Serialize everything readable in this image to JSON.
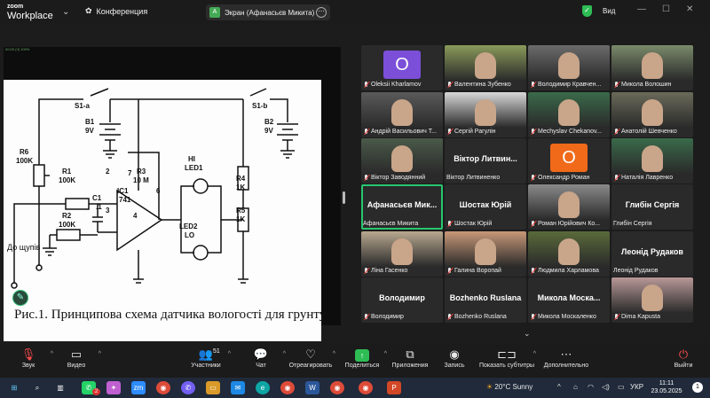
{
  "app": {
    "logo_line1": "zoom",
    "logo_line2": "Workplace",
    "conference_label": "Конференция"
  },
  "share": {
    "avatar_letter": "A",
    "label": "Экран (Афанасьєв Микита)",
    "more_symbol": "⋯"
  },
  "header_right": {
    "view_label": "Вид"
  },
  "screen": {
    "meta": "00:00 (!!) 100%",
    "schematic_labels": {
      "s1a": "S1-a",
      "s1b": "S1-b",
      "b1": "B1",
      "b1v": "9V",
      "b2": "B2",
      "b2v": "9V",
      "r6": "R6",
      "r6v": "100K",
      "r1": "R1",
      "r1v": "100K",
      "c1": "C1",
      "c1v": ".1",
      "r2": "R2",
      "r2v": "100K",
      "ic1": "IC1",
      "ic1v": "741",
      "r3": "R3",
      "r3v": "10 M",
      "pin2": "2",
      "pin3": "3",
      "pin7": "7",
      "pin6": "6",
      "pin4": "4",
      "hi": "HI",
      "led1": "LED1",
      "led2": "LED2",
      "lo": "LO",
      "r4": "R4",
      "r4v": "1K",
      "r5": "R5",
      "r5v": "1K",
      "probes": "До щупів"
    },
    "caption": "Рис.1. Принципова схема датчика вологості для грунту"
  },
  "participants": [
    {
      "name": "Oleksii Kharlamov",
      "muted": true,
      "type": "letter",
      "letter": "O",
      "color": "#7b4fd8"
    },
    {
      "name": "Валентина Зубенко",
      "muted": true,
      "type": "camera",
      "color": "#8a9a5a"
    },
    {
      "name": "Володимир Кравчен...",
      "muted": true,
      "type": "camera",
      "color": "#6b6b6b"
    },
    {
      "name": "Микола Волошин",
      "muted": true,
      "type": "camera",
      "color": "#7a8a6a"
    },
    {
      "name": "Андрій Васильович Т...",
      "muted": true,
      "type": "camera",
      "color": "#5a5a5a"
    },
    {
      "name": "Сергій Рагулін",
      "muted": true,
      "type": "camera",
      "color": "#d8d8d8"
    },
    {
      "name": "Mechyslav Chekanov...",
      "muted": true,
      "type": "camera",
      "color": "#3a6a4a"
    },
    {
      "name": "Анатолій Шевченко",
      "muted": true,
      "type": "camera",
      "color": "#6a6a5a"
    },
    {
      "name": "Віктор Заводянний",
      "muted": true,
      "type": "camera",
      "color": "#4a5a4a"
    },
    {
      "name": "Віктор Литвиненко",
      "muted": false,
      "type": "name",
      "display": "Віктор  Литвин..."
    },
    {
      "name": "Олександр Роман",
      "muted": true,
      "type": "letter",
      "letter": "O",
      "color": "#f06a1a"
    },
    {
      "name": "Наталія Лавренко",
      "muted": true,
      "type": "camera",
      "color": "#3a6a4a"
    },
    {
      "name": "Афанасьєв Микита",
      "muted": false,
      "type": "name",
      "display": "Афанасьєв  Мик...",
      "active": true
    },
    {
      "name": "Шостак Юрій",
      "muted": true,
      "type": "name",
      "display": "Шостак Юрій"
    },
    {
      "name": "Роман Юрійович Ко...",
      "muted": true,
      "type": "camera",
      "color": "#8a8a8a"
    },
    {
      "name": "Глибін Сергія",
      "muted": false,
      "type": "name",
      "display": "Глибін Сергія"
    },
    {
      "name": "Ліна Гасенко",
      "muted": true,
      "type": "camera",
      "color": "#b8a890"
    },
    {
      "name": "Галина Воропай",
      "muted": true,
      "type": "camera",
      "color": "#c89878"
    },
    {
      "name": "Людмила Харламова",
      "muted": true,
      "type": "camera",
      "color": "#5a6a3a"
    },
    {
      "name": "Леонід Рудаков",
      "muted": false,
      "type": "name",
      "display": "Леонід Рудаков"
    },
    {
      "name": "Володимир",
      "muted": true,
      "type": "name",
      "display": "Володимир"
    },
    {
      "name": "Bozhenko Ruslana",
      "muted": true,
      "type": "name",
      "display": "Bozhenko Ruslana"
    },
    {
      "name": "Микола Москаленко",
      "muted": true,
      "type": "name",
      "display": "Микола  Моска..."
    },
    {
      "name": "Dima Kapusta",
      "muted": true,
      "type": "camera",
      "color": "#b89898"
    }
  ],
  "toolbar": {
    "audio": "Звук",
    "video": "Видео",
    "participants": "Участники",
    "participants_count": "51",
    "chat": "Чат",
    "react": "Отреагировать",
    "share": "Поделиться",
    "apps": "Приложения",
    "record": "Запись",
    "captions": "Показать субтитры",
    "more": "Дополнительно",
    "exit": "Выйти"
  },
  "taskbar": {
    "badge": "2",
    "weather": "20°C  Sunny",
    "lang": "УКР",
    "time": "11:11",
    "date": "23.05.2025",
    "notif": "1"
  }
}
